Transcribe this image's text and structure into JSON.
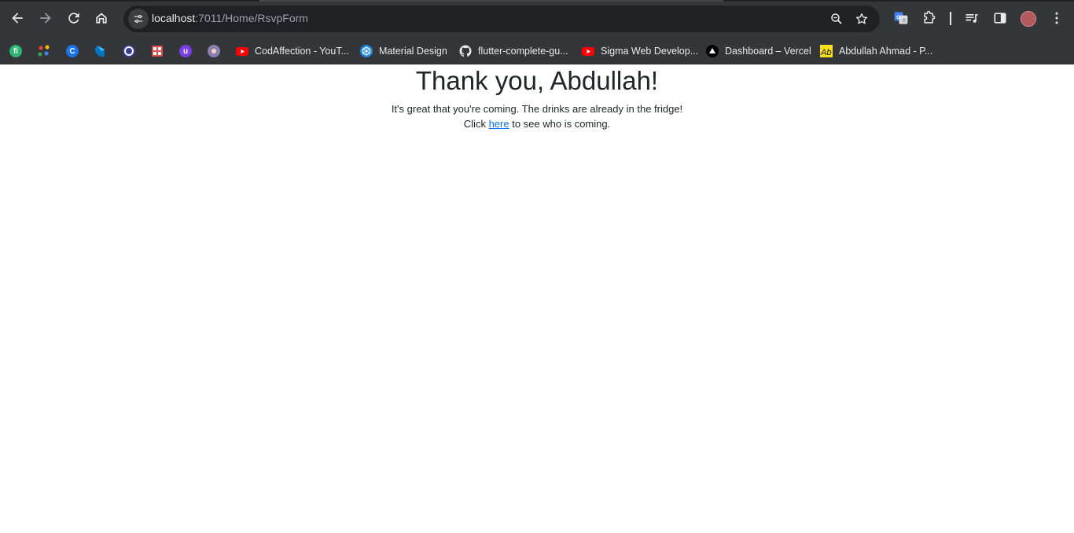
{
  "browser": {
    "url_host": "localhost",
    "url_rest": ":7011/Home/RsvpForm",
    "icons": {
      "back": "arrow-left-icon",
      "forward": "arrow-right-icon",
      "reload": "reload-icon",
      "home": "home-icon",
      "site_info": "tune-icon",
      "zoom": "zoom-icon",
      "bookmark": "star-icon",
      "translate": "google-translate-icon",
      "extensions": "puzzle-icon",
      "media": "media-queue-icon",
      "side_panel": "side-panel-icon",
      "menu": "kebab-menu-icon"
    }
  },
  "bookmarks": [
    {
      "icon": "fh-logo-icon",
      "color": "#2bb673",
      "label": ""
    },
    {
      "icon": "dots-logo-icon",
      "color": "#f4b400",
      "label": ""
    },
    {
      "icon": "c-logo-icon",
      "color": "#1a73e8",
      "label": ""
    },
    {
      "icon": "dart-logo-icon",
      "color": "#0175c2",
      "label": ""
    },
    {
      "icon": "circle-logo-icon",
      "color": "#5b5fc7",
      "label": ""
    },
    {
      "icon": "grid-logo-icon",
      "color": "#e04b4b",
      "label": ""
    },
    {
      "icon": "u-logo-icon",
      "color": "#7b3fe4",
      "label": ""
    },
    {
      "icon": "avatar-logo-icon",
      "color": "#8a7fb0",
      "label": ""
    },
    {
      "icon": "youtube-icon",
      "color": "#ff0000",
      "label": "CodAffection - YouT..."
    },
    {
      "icon": "material-design-icon",
      "color": "#1e88e5",
      "label": "Material Design"
    },
    {
      "icon": "github-icon",
      "color": "#ffffff",
      "label": "flutter-complete-gu..."
    },
    {
      "icon": "youtube-icon",
      "color": "#ff0000",
      "label": "Sigma Web Develop..."
    },
    {
      "icon": "vercel-icon",
      "color": "#000000",
      "label": "Dashboard – Vercel"
    },
    {
      "icon": "ah-logo-icon",
      "color": "#f7e018",
      "label": "Abdullah Ahmad - P..."
    }
  ],
  "page": {
    "heading": "Thank you, Abdullah!",
    "message": "It's great that you're coming. The drinks are already in the fridge!",
    "click_prefix": "Click ",
    "link_text": "here",
    "click_suffix": " to see who is coming."
  }
}
